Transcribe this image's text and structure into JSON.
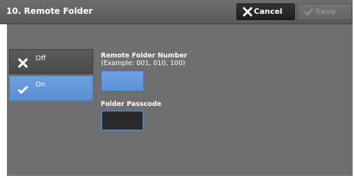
{
  "header": {
    "title": "10. Remote Folder",
    "cancel_label": "Cancel",
    "save_label": "Save",
    "cancel_icon": "close-icon",
    "save_icon": "check-icon"
  },
  "options": [
    {
      "label": "Off",
      "icon": "close-icon",
      "selected": false
    },
    {
      "label": "On",
      "icon": "check-icon",
      "selected": true
    }
  ],
  "fields": {
    "number_label": "Remote Folder Number",
    "number_example": "(Example: 001, 010, 100)",
    "number_value": "",
    "passcode_label": "Folder Passcode",
    "passcode_value": ""
  },
  "colors": {
    "header_bg": "#666666",
    "panel_bg": "#6f6f6f",
    "selected_blue": "#6a9bdd",
    "cancel_bg": "#262626",
    "passcode_bg": "#2a2a2a"
  }
}
